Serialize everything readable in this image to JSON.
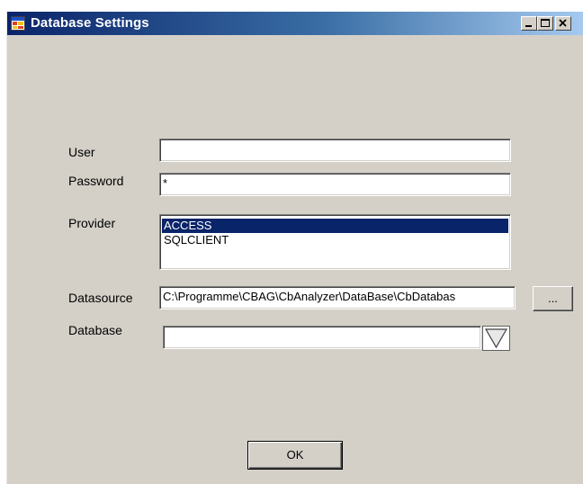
{
  "window": {
    "title": "Database Settings",
    "icon": "app-database-icon"
  },
  "title_buttons": {
    "minimize": "minimize-icon",
    "maximize": "maximize-icon",
    "close": "close-icon"
  },
  "form": {
    "user_label": "User",
    "user_value": "",
    "password_label": "Password",
    "password_value": "*",
    "provider_label": "Provider",
    "provider_options": [
      "ACCESS",
      "SQLCLIENT"
    ],
    "provider_selected": "ACCESS",
    "datasource_label": "Datasource",
    "datasource_value": "C:\\Programme\\CBAG\\CbAnalyzer\\DataBase\\CbDatabas",
    "browse_label": "...",
    "database_label": "Database",
    "database_value": ""
  },
  "ok_label": "OK",
  "colors": {
    "face": "#d4d0c8",
    "selection": "#0a246a",
    "title_start": "#0a246a",
    "title_end": "#a6caf0"
  }
}
